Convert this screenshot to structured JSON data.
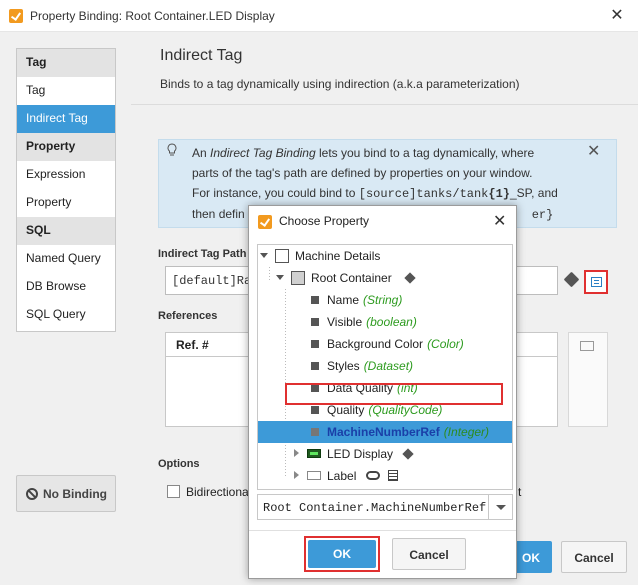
{
  "window": {
    "title": "Property Binding: Root Container.LED Display",
    "close": "✕"
  },
  "sidebar": {
    "groups": [
      {
        "header": "Tag",
        "items": [
          "Tag",
          "Indirect Tag"
        ]
      },
      {
        "header": "Property",
        "items": [
          "Expression",
          "Property"
        ]
      },
      {
        "header": "SQL",
        "items": [
          "Named Query",
          "DB Browse",
          "SQL Query"
        ]
      }
    ],
    "selected": "Indirect Tag",
    "no_binding": "No Binding"
  },
  "content": {
    "title": "Indirect Tag",
    "description": "Binds to a tag dynamically using indirection (a.k.a parameterization)",
    "info": {
      "prefix": "An ",
      "em": "Indirect Tag Binding",
      "line1_rest": " lets you bind to a tag dynamically, where",
      "line2": "parts of the tag's path are defined by properties on your window.",
      "line3_pre": "For instance, you could bind to ",
      "line3_code_a": "[source]tanks/tank",
      "line3_code_b": "{1}",
      "line3_code_c": "_SP",
      "line3_post": ", and",
      "line4_pre": "then defin",
      "line4_post": "er}"
    },
    "indirect_tag_path_label": "Indirect Tag Path",
    "indirect_tag_path_value": "[default]Ra",
    "references_label": "References",
    "references_col": "Ref. #",
    "options_label": "Options",
    "bidirectional": "Bidirectional",
    "trailing": "t",
    "ok": "OK",
    "cancel": "Cancel"
  },
  "dialog": {
    "title": "Choose Property",
    "close": "✕",
    "tree": {
      "root": "Machine Details",
      "container": "Root Container",
      "properties": [
        {
          "name": "Name",
          "type": "(String)"
        },
        {
          "name": "Visible",
          "type": "(boolean)"
        },
        {
          "name": "Background Color",
          "type": "(Color)"
        },
        {
          "name": "Styles",
          "type": "(Dataset)"
        },
        {
          "name": "Data Quality",
          "type": "(int)"
        },
        {
          "name": "Quality",
          "type": "(QualityCode)"
        },
        {
          "name": "MachineNumberRef",
          "type": "(Integer)"
        }
      ],
      "children": [
        "LED Display",
        "Label"
      ]
    },
    "selected_path": "Root Container.MachineNumberRef",
    "ok": "OK",
    "cancel": "Cancel"
  },
  "colors": {
    "accent": "#3d9ad8",
    "highlight": "#e03030",
    "type_text": "#2d9b1f"
  }
}
